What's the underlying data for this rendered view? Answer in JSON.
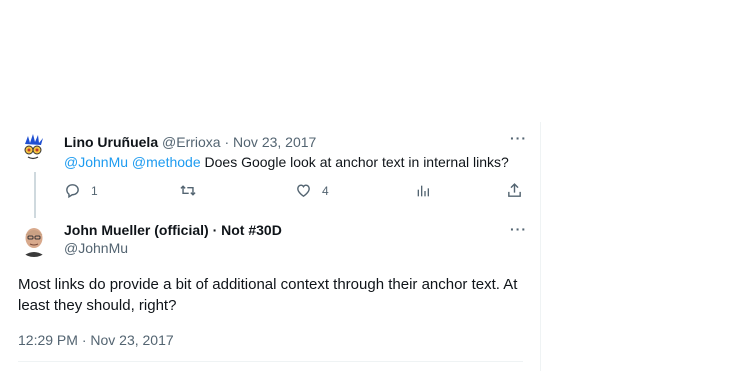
{
  "reply_to": {
    "author_name": "Lino Uruñuela",
    "author_handle": "@Errioxa",
    "separator": "·",
    "date": "Nov 23, 2017",
    "mention_1": "@JohnMu",
    "mention_2": "@methode",
    "text": "Does Google look at anchor text in internal links?",
    "more_label": "···",
    "reply_count": "1",
    "like_count": "4"
  },
  "tweet": {
    "author_name": "John Mueller (official) · Not #30D",
    "author_handle": "@JohnMu",
    "more_label": "···",
    "text": "Most links do provide a bit of additional context through their anchor text. At least they should, right?",
    "timestamp": "12:29 PM · Nov 23, 2017"
  },
  "icons": {
    "reply": "reply-icon",
    "retweet": "retweet-icon",
    "like": "heart-icon",
    "views": "analytics-icon",
    "share": "share-icon",
    "more": "more-icon"
  },
  "colors": {
    "link": "#1d9bf0",
    "muted": "#536471",
    "text": "#0f1419",
    "thread_line": "#cfd9de"
  }
}
